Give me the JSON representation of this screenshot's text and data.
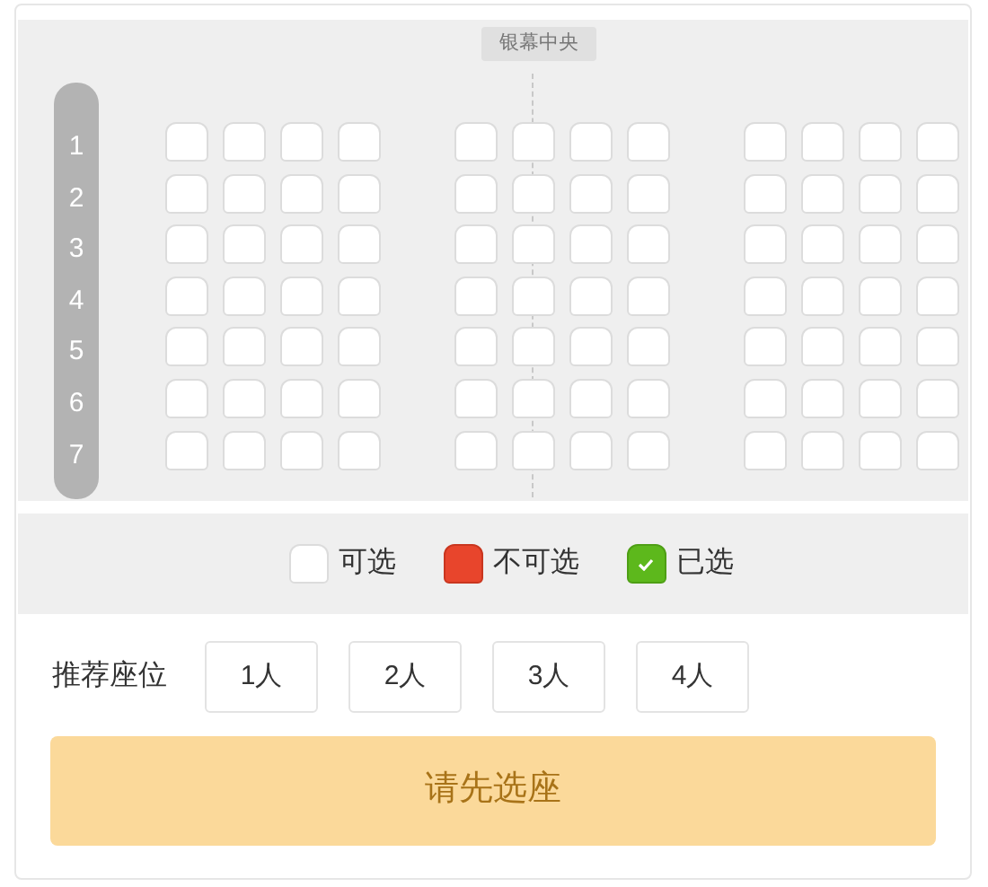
{
  "screen_label": "银幕中央",
  "rows": [
    {
      "label": "1",
      "blocks": [
        [
          {
            "sold": false,
            "selected": false
          },
          {
            "sold": false,
            "selected": false
          },
          {
            "sold": false,
            "selected": false
          },
          {
            "sold": false,
            "selected": false
          }
        ],
        [
          {
            "sold": false,
            "selected": false
          },
          {
            "sold": false,
            "selected": false
          },
          {
            "sold": false,
            "selected": false
          },
          {
            "sold": false,
            "selected": false
          }
        ],
        [
          {
            "sold": false,
            "selected": false
          },
          {
            "sold": false,
            "selected": false
          },
          {
            "sold": false,
            "selected": false
          },
          {
            "sold": false,
            "selected": false
          }
        ]
      ]
    },
    {
      "label": "2",
      "blocks": [
        [
          {
            "sold": false,
            "selected": false
          },
          {
            "sold": false,
            "selected": false
          },
          {
            "sold": false,
            "selected": false
          },
          {
            "sold": false,
            "selected": false
          }
        ],
        [
          {
            "sold": false,
            "selected": false
          },
          {
            "sold": false,
            "selected": false
          },
          {
            "sold": false,
            "selected": false
          },
          {
            "sold": false,
            "selected": false
          }
        ],
        [
          {
            "sold": false,
            "selected": false
          },
          {
            "sold": false,
            "selected": false
          },
          {
            "sold": false,
            "selected": false
          },
          {
            "sold": false,
            "selected": false
          }
        ]
      ]
    },
    {
      "label": "3",
      "blocks": [
        [
          {
            "sold": false,
            "selected": false
          },
          {
            "sold": false,
            "selected": false
          },
          {
            "sold": false,
            "selected": false
          },
          {
            "sold": false,
            "selected": false
          }
        ],
        [
          {
            "sold": false,
            "selected": false
          },
          {
            "sold": false,
            "selected": false
          },
          {
            "sold": false,
            "selected": false
          },
          {
            "sold": false,
            "selected": false
          }
        ],
        [
          {
            "sold": false,
            "selected": false
          },
          {
            "sold": false,
            "selected": false
          },
          {
            "sold": false,
            "selected": false
          },
          {
            "sold": false,
            "selected": false
          }
        ]
      ]
    },
    {
      "label": "4",
      "blocks": [
        [
          {
            "sold": false,
            "selected": false
          },
          {
            "sold": false,
            "selected": false
          },
          {
            "sold": false,
            "selected": false
          },
          {
            "sold": false,
            "selected": false
          }
        ],
        [
          {
            "sold": false,
            "selected": false
          },
          {
            "sold": false,
            "selected": false
          },
          {
            "sold": false,
            "selected": false
          },
          {
            "sold": false,
            "selected": false
          }
        ],
        [
          {
            "sold": false,
            "selected": false
          },
          {
            "sold": false,
            "selected": false
          },
          {
            "sold": false,
            "selected": false
          },
          {
            "sold": false,
            "selected": false
          }
        ]
      ]
    },
    {
      "label": "5",
      "blocks": [
        [
          {
            "sold": false,
            "selected": false
          },
          {
            "sold": false,
            "selected": false
          },
          {
            "sold": false,
            "selected": false
          },
          {
            "sold": false,
            "selected": false
          }
        ],
        [
          {
            "sold": false,
            "selected": false
          },
          {
            "sold": false,
            "selected": false
          },
          {
            "sold": false,
            "selected": false
          },
          {
            "sold": false,
            "selected": false
          }
        ],
        [
          {
            "sold": false,
            "selected": false
          },
          {
            "sold": false,
            "selected": false
          },
          {
            "sold": false,
            "selected": false
          },
          {
            "sold": false,
            "selected": false
          }
        ]
      ]
    },
    {
      "label": "6",
      "blocks": [
        [
          {
            "sold": false,
            "selected": false
          },
          {
            "sold": false,
            "selected": false
          },
          {
            "sold": false,
            "selected": false
          },
          {
            "sold": false,
            "selected": false
          }
        ],
        [
          {
            "sold": false,
            "selected": false
          },
          {
            "sold": false,
            "selected": false
          },
          {
            "sold": false,
            "selected": false
          },
          {
            "sold": false,
            "selected": false
          }
        ],
        [
          {
            "sold": false,
            "selected": false
          },
          {
            "sold": false,
            "selected": false
          },
          {
            "sold": false,
            "selected": false
          },
          {
            "sold": false,
            "selected": false
          }
        ]
      ]
    },
    {
      "label": "7",
      "blocks": [
        [
          {
            "sold": false,
            "selected": false
          },
          {
            "sold": false,
            "selected": false
          },
          {
            "sold": false,
            "selected": false
          },
          {
            "sold": false,
            "selected": false
          }
        ],
        [
          {
            "sold": false,
            "selected": false
          },
          {
            "sold": false,
            "selected": false
          },
          {
            "sold": false,
            "selected": false
          },
          {
            "sold": false,
            "selected": false
          }
        ],
        [
          {
            "sold": false,
            "selected": false
          },
          {
            "sold": false,
            "selected": false
          },
          {
            "sold": false,
            "selected": false
          },
          {
            "sold": false,
            "selected": false
          }
        ]
      ]
    }
  ],
  "legend": [
    {
      "kind": "available",
      "label": "可选"
    },
    {
      "kind": "sold",
      "label": "不可选"
    },
    {
      "kind": "selected",
      "label": "已选"
    }
  ],
  "recommend": {
    "label": "推荐座位",
    "options": [
      "1人",
      "2人",
      "3人",
      "4人"
    ]
  },
  "confirm": {
    "label": "请先选座",
    "disabled": true
  }
}
